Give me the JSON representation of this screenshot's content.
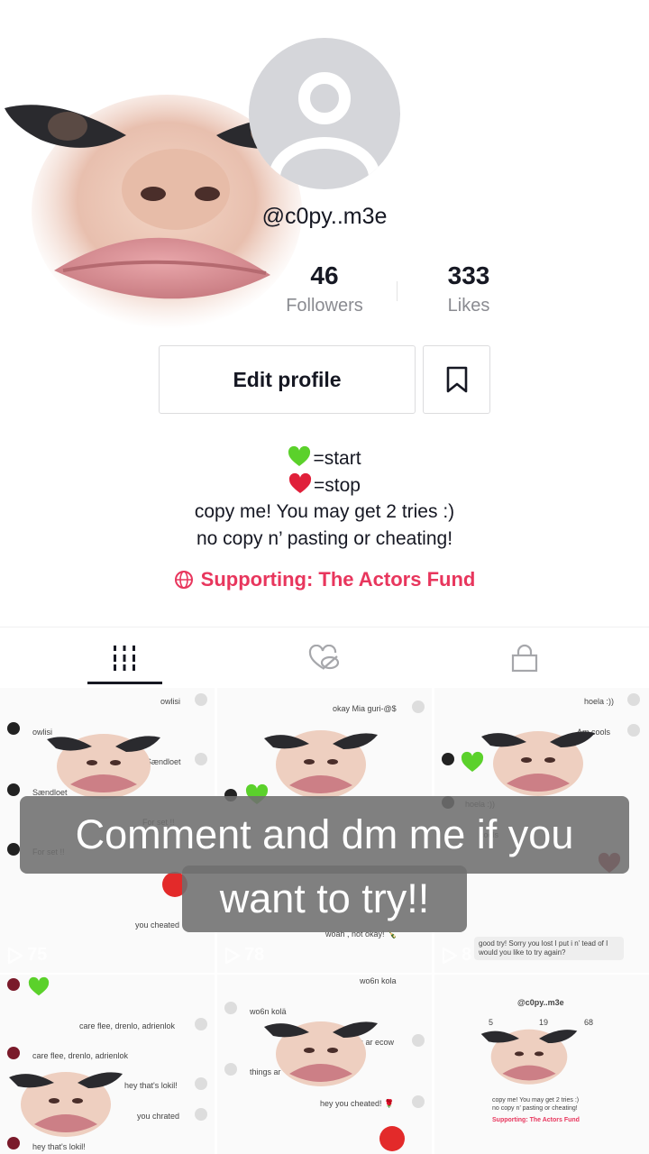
{
  "profile": {
    "username": "@c0py..m3e",
    "followers_count": "46",
    "followers_label": "Followers",
    "likes_count": "333",
    "likes_label": "Likes",
    "edit_profile_label": "Edit profile"
  },
  "bio": {
    "line1": "=start",
    "line2": "=stop",
    "line3": "copy me! You may get 2 tries :)",
    "line4": "no copy n’ pasting or cheating!",
    "line1_icon": "green-heart-emoji",
    "line2_icon": "red-heart-emoji"
  },
  "supporting": {
    "label": "Supporting: The Actors Fund",
    "icon": "globe-heart-icon",
    "color": "#e8365d"
  },
  "tabs": [
    {
      "name": "videos",
      "icon": "grid-bars-icon",
      "active": true
    },
    {
      "name": "liked",
      "icon": "hidden-heart-icon",
      "active": false
    },
    {
      "name": "private",
      "icon": "lock-icon",
      "active": false
    }
  ],
  "videos": [
    {
      "views": "75",
      "comments": [
        "owlisi",
        "owlisi",
        "Sændloet",
        "Sændloet",
        "For set !!",
        "For set !!",
        "you cheated"
      ]
    },
    {
      "views": "78",
      "comments": [
        "okay Mia guri-@$",
        "woah , not okay! 🍾"
      ]
    },
    {
      "views": "8",
      "comments": [
        "hoela :))",
        "Am cools",
        "hoela :))",
        "cools",
        "good try! Sorry you lost I put i n’ tead of I would you like to try again?"
      ]
    },
    {
      "views": "",
      "comments": [
        "care flee, drenlo, adrienlok",
        "care flee, drenlo, adrienlok",
        "hey that's lokil!",
        "you chrated",
        "hey that's lokil!"
      ]
    },
    {
      "views": "",
      "comments": [
        "wo6n kola",
        "wo6n kolä",
        "things ar ecow",
        "things ar",
        "hey you cheated! 🌹"
      ]
    },
    {
      "views": "",
      "comments": [
        "@c0py..m3e",
        "copy me! You may get 2 tries :)",
        "no copy n’ pasting or cheating!",
        "Supporting: The Actors Fund"
      ],
      "stats": [
        "5",
        "19",
        "68"
      ]
    }
  ],
  "overlay": {
    "line1": "Comment and dm me if you",
    "line2": "want to try!!"
  }
}
